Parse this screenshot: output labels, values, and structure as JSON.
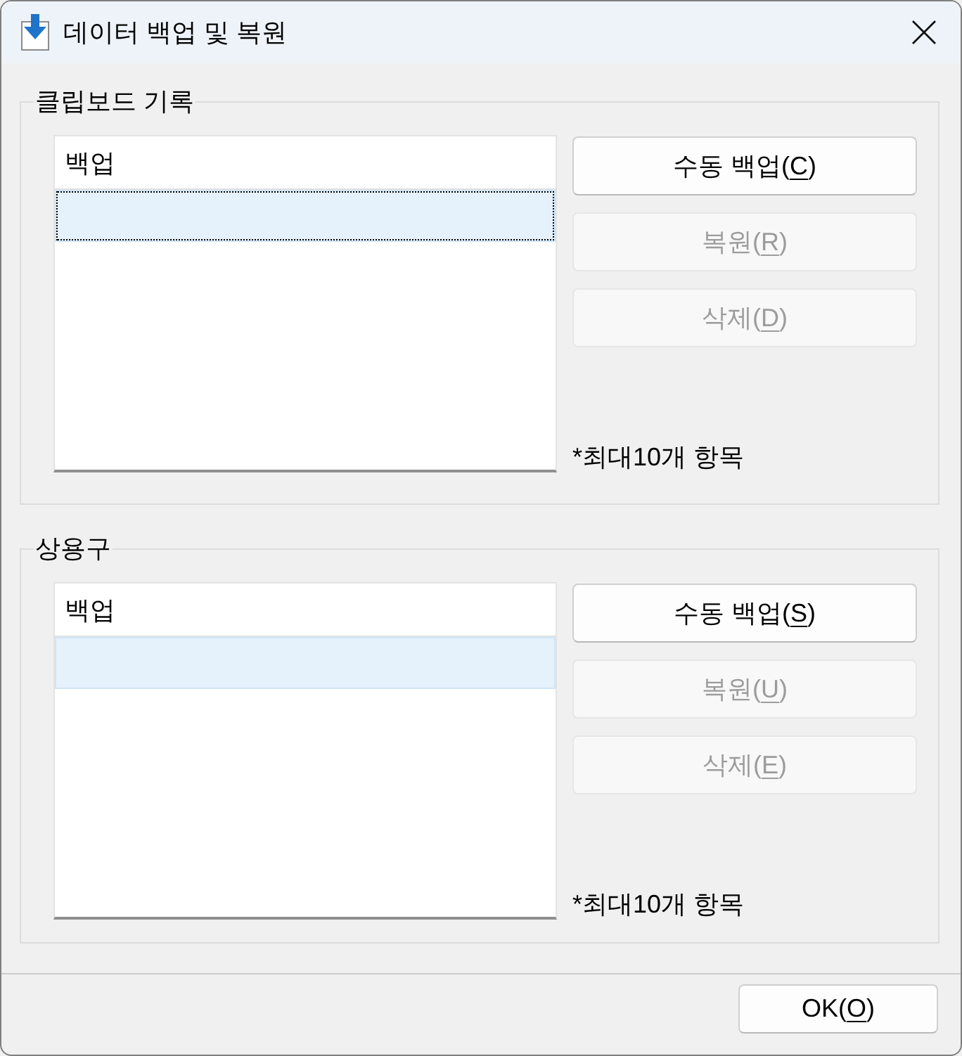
{
  "window": {
    "title": "데이터 백업 및 복원"
  },
  "groups": [
    {
      "title": "클립보드 기록",
      "list": {
        "column": "백업",
        "rows": [
          {
            "selected": true,
            "focused": true
          }
        ]
      },
      "buttons": [
        {
          "label": "수동 백업(",
          "access_key": "C",
          "label_end": ")",
          "disabled": false
        },
        {
          "label": "복원(",
          "access_key": "R",
          "label_end": ")",
          "disabled": true
        },
        {
          "label": "삭제(",
          "access_key": "D",
          "label_end": ")",
          "disabled": true
        }
      ],
      "note": "*최대10개 항목"
    },
    {
      "title": "상용구",
      "list": {
        "column": "백업",
        "rows": [
          {
            "selected": true,
            "focused": false
          }
        ]
      },
      "buttons": [
        {
          "label": "수동 백업(",
          "access_key": "S",
          "label_end": ")",
          "disabled": false
        },
        {
          "label": "복원(",
          "access_key": "U",
          "label_end": ")",
          "disabled": true
        },
        {
          "label": "삭제(",
          "access_key": "E",
          "label_end": ")",
          "disabled": true
        }
      ],
      "note": "*최대10개 항목"
    }
  ],
  "footer": {
    "buttons": [
      {
        "label": "OK(",
        "access_key": "O",
        "label_end": ")",
        "disabled": false
      }
    ]
  }
}
